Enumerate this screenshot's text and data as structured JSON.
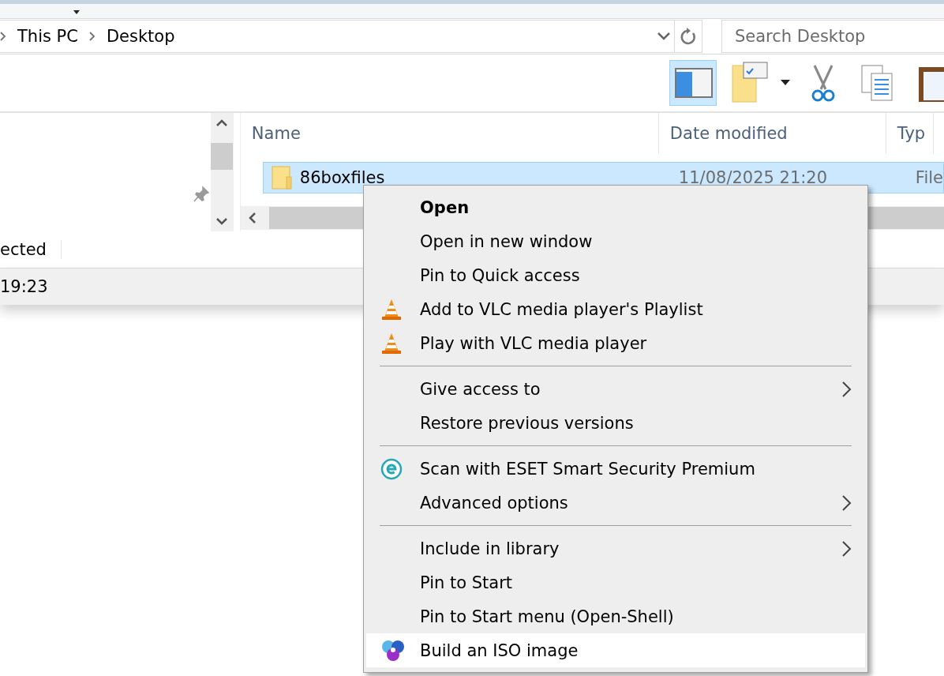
{
  "explorer": {
    "breadcrumb": [
      "This PC",
      "Desktop"
    ],
    "search": {
      "placeholder": "Search Desktop"
    },
    "toolbar": [
      {
        "kind": "preview-pane",
        "selected": true
      },
      {
        "kind": "properties",
        "selected": false
      },
      {
        "kind": "cut",
        "selected": false
      },
      {
        "kind": "copy",
        "selected": false
      },
      {
        "kind": "paste",
        "selected": false
      }
    ],
    "columns": [
      "Name",
      "Date modified",
      "Typ"
    ],
    "rows": [
      {
        "name": "86boxfiles",
        "date": "11/08/2025 21:20",
        "type": "File",
        "selected": true
      }
    ],
    "status_text": "ected",
    "details_time": "19:23"
  },
  "context_menu": {
    "groups": [
      [
        {
          "label": "Open",
          "kind": "plain",
          "default": true,
          "submenu": false,
          "selected": false
        },
        {
          "label": "Open in new window",
          "kind": "plain",
          "default": false,
          "submenu": false,
          "selected": false
        },
        {
          "label": "Pin to Quick access",
          "kind": "plain",
          "default": false,
          "submenu": false,
          "selected": false
        },
        {
          "label": "Add to VLC media player's Playlist",
          "kind": "vlc",
          "default": false,
          "submenu": false,
          "selected": false
        },
        {
          "label": "Play with VLC media player",
          "kind": "vlc",
          "default": false,
          "submenu": false,
          "selected": false
        }
      ],
      [
        {
          "label": "Give access to",
          "kind": "plain",
          "default": false,
          "submenu": true,
          "selected": false
        },
        {
          "label": "Restore previous versions",
          "kind": "plain",
          "default": false,
          "submenu": false,
          "selected": false
        }
      ],
      [
        {
          "label": "Scan with ESET Smart Security Premium",
          "kind": "eset",
          "default": false,
          "submenu": false,
          "selected": false
        },
        {
          "label": "Advanced options",
          "kind": "plain",
          "default": false,
          "submenu": true,
          "selected": false
        }
      ],
      [
        {
          "label": "Include in library",
          "kind": "plain",
          "default": false,
          "submenu": true,
          "selected": false
        },
        {
          "label": "Pin to Start",
          "kind": "plain",
          "default": false,
          "submenu": false,
          "selected": false
        },
        {
          "label": "Pin to Start menu (Open-Shell)",
          "kind": "plain",
          "default": false,
          "submenu": false,
          "selected": false
        },
        {
          "label": "Build an ISO image",
          "kind": "iso",
          "default": false,
          "submenu": false,
          "selected": true
        }
      ]
    ]
  }
}
